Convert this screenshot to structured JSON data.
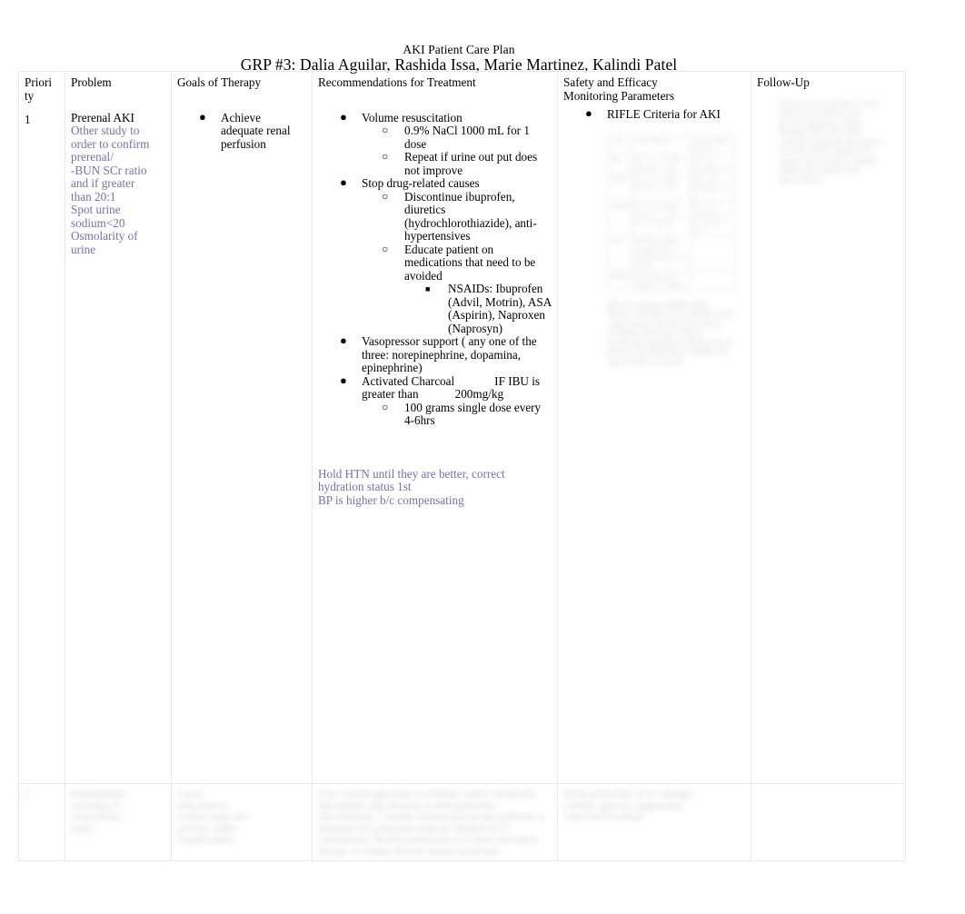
{
  "document": {
    "header_right": "AKI Patient Care Plan",
    "title": "GRP #3: Dalia Aguilar, Rashida Issa, Marie Martinez, Kalindi Patel"
  },
  "table": {
    "headers": {
      "priority_line1": "Priori",
      "priority_line2": "ty",
      "problem": "Problem",
      "goals": "Goals of Therapy",
      "recommendations": "Recommendations for Treatment",
      "safety_line1": "Safety and Efficacy",
      "safety_line2": "Monitoring Parameters",
      "followup": "Follow-Up"
    },
    "row1": {
      "priority": "1",
      "problem": {
        "main": "Prerenal AKI",
        "notes": [
          "Other study to",
          "order to confirm",
          "prerenal/",
          "-BUN SCr ratio",
          "and if greater",
          "than 20:1",
          "Spot urine",
          "sodium<20",
          "Osmolarity of",
          "urine"
        ]
      },
      "goals": [
        "Achieve adequate renal perfusion"
      ],
      "recommendations": [
        {
          "level": 1,
          "text": "Volume resuscitation",
          "children": [
            {
              "level": 2,
              "text": "0.9% NaCl 1000 mL for 1 dose"
            },
            {
              "level": 2,
              "text": "Repeat if urine out put does not improve"
            }
          ]
        },
        {
          "level": 1,
          "text": "Stop drug-related causes",
          "children": [
            {
              "level": 2,
              "text": "Discontinue ibuprofen, diuretics (hydrochlorothiazide), anti-hypertensives"
            },
            {
              "level": 2,
              "text": "Educate patient on medications that need to be avoided",
              "children": [
                {
                  "level": 3,
                  "text": "NSAIDs: Ibuprofen (Advil, Motrin), ASA (Aspirin), Naproxen (Naprosyn)"
                }
              ]
            }
          ]
        },
        {
          "level": 1,
          "text": "Vasopressor support ( any one of the three: norepinephrine, dopamina, epinephrine)"
        },
        {
          "level": 1,
          "text_a": "Activated Charcoal",
          "text_b": "IF  IBU is",
          "text_c": "greater than",
          "text_d": "200mg/kg",
          "children": [
            {
              "level": 2,
              "text": "100 grams single dose every 4-6hrs"
            }
          ]
        }
      ],
      "recommendation_notes": [
        "Hold HTN until they are better, correct",
        "hydration status 1st",
        "BP is higher b/c compensating"
      ],
      "safety": [
        {
          "level": 1,
          "text": "RIFLE Criteria for AKI"
        }
      ],
      "safety_blurred_label": "blurred RIFLE criteria table image",
      "followup_blurred_label": "blurred follow-up content"
    },
    "row2": {
      "priority_blurred": "2",
      "problem_blurred": "blurred problem text",
      "goals_blurred": "blurred goals text",
      "recommendations_blurred": "blurred recommendations text",
      "safety_blurred": "blurred safety text",
      "followup_blurred": "blurred follow-up text"
    }
  }
}
